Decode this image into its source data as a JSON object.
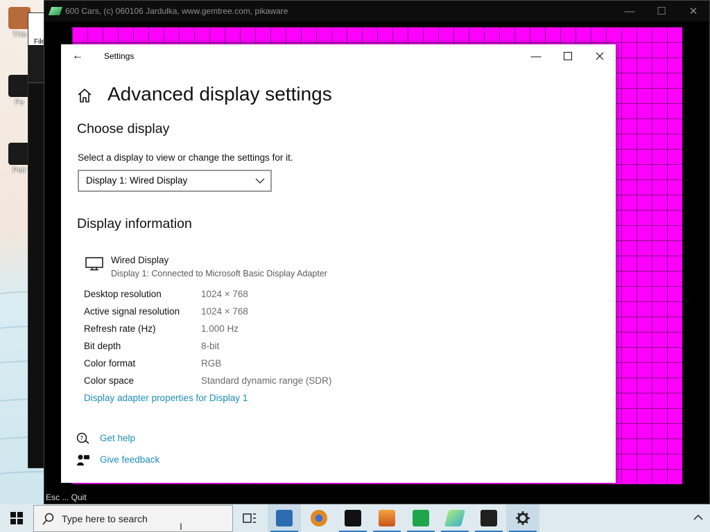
{
  "desktop": {
    "icons": [
      {
        "label": "This",
        "color": "#b86b3a"
      },
      {
        "label": "Pe",
        "color": "#1a1a1a"
      },
      {
        "label": "Petr",
        "color": "#1a1a1a"
      }
    ],
    "bg_app": {
      "menu_label": "File"
    }
  },
  "game_window": {
    "title": "600 Cars, (c) 060106 Jardulka, www.gemtree.com, pikaware",
    "status": "Esc ... Quit",
    "canvas_color": "#ff00ff"
  },
  "settings": {
    "window_title": "Settings",
    "page_title": "Advanced display settings",
    "choose_display": {
      "heading": "Choose display",
      "description": "Select a display to view or change the settings for it.",
      "selected": "Display 1: Wired Display"
    },
    "display_info": {
      "heading": "Display information",
      "name": "Wired Display",
      "subtitle": "Display 1: Connected to Microsoft Basic Display Adapter",
      "rows": [
        {
          "key": "Desktop resolution",
          "value": "1024 × 768"
        },
        {
          "key": "Active signal resolution",
          "value": "1024 × 768"
        },
        {
          "key": "Refresh rate (Hz)",
          "value": "1.000 Hz"
        },
        {
          "key": "Bit depth",
          "value": "8-bit"
        },
        {
          "key": "Color format",
          "value": "RGB"
        },
        {
          "key": "Color space",
          "value": "Standard dynamic range (SDR)"
        }
      ],
      "adapter_link": "Display adapter properties for Display 1"
    },
    "help": {
      "get_help": "Get help",
      "give_feedback": "Give feedback"
    },
    "accent_color": "#1d8ebd"
  },
  "taskbar": {
    "search_placeholder": "Type here to search",
    "apps": [
      {
        "name": "task-view",
        "color": "#222222"
      },
      {
        "name": "file-explorer",
        "color": "#2b6cb0"
      },
      {
        "name": "browser",
        "color": "#e08a1e"
      },
      {
        "name": "petr-app",
        "color": "#111111"
      },
      {
        "name": "sunset-app",
        "color": "#e07b24"
      },
      {
        "name": "green-app",
        "color": "#1fa64b"
      },
      {
        "name": "cars-app",
        "color": "#4fc3a1"
      },
      {
        "name": "dark-app",
        "color": "#202020"
      },
      {
        "name": "settings-app",
        "color": "#222222"
      }
    ]
  }
}
